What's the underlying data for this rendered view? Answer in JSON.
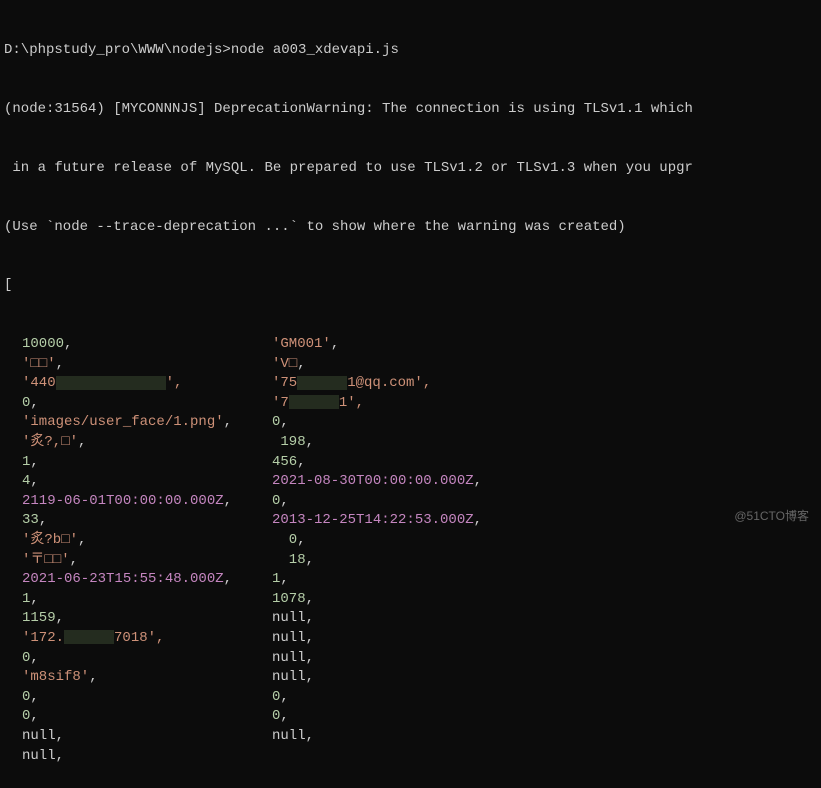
{
  "prompt_path": "D:\\phpstudy_pro\\WWW\\nodejs>",
  "command": "node a003_xdevapi.js",
  "warning_lines": [
    "(node:31564) [MYCONNNJS] DeprecationWarning: The connection is using TLSv1.1 which",
    " in a future release of MySQL. Be prepared to use TLSv1.2 or TLSv1.3 when you upgr",
    "(Use `node --trace-deprecation ...` to show where the warning was created)"
  ],
  "open_bracket": "[",
  "rows": [
    {
      "l": {
        "t": "num",
        "v": "10000"
      },
      "r": {
        "t": "str",
        "v": "'GM001'"
      }
    },
    {
      "l": {
        "t": "str",
        "v": "'□□'"
      },
      "r": {
        "t": "str",
        "v": "'V□"
      }
    },
    {
      "l": {
        "t": "str",
        "v": "'440",
        "censor": 110,
        "after": "',"
      },
      "r": {
        "t": "str",
        "v": "'75",
        "censor": 50,
        "after": "1@qq.com',"
      }
    },
    {
      "l": {
        "t": "num",
        "v": "0"
      },
      "r": {
        "t": "str",
        "v": "'7",
        "censor": 50,
        "after": "1',"
      }
    },
    {
      "l": {
        "t": "str",
        "v": "'images/user_face/1.png'"
      },
      "r": {
        "t": "num",
        "v": "0"
      }
    },
    {
      "l": {
        "t": "str",
        "v": "'炙?,□'"
      },
      "r": {
        "t": "num",
        "v": " 198",
        "indent": true
      }
    },
    {
      "l": {
        "t": "num",
        "v": "1"
      },
      "r": {
        "t": "num",
        "v": "456"
      }
    },
    {
      "l": {
        "t": "num",
        "v": "4"
      },
      "r": {
        "t": "date",
        "v": "2021-08-30T00:00:00.000Z"
      }
    },
    {
      "l": {
        "t": "date",
        "v": "2119-06-01T00:00:00.000Z"
      },
      "r": {
        "t": "num",
        "v": "0"
      }
    },
    {
      "l": {
        "t": "num",
        "v": "33"
      },
      "r": {
        "t": "date",
        "v": "2013-12-25T14:22:53.000Z"
      }
    },
    {
      "l": {
        "t": "str",
        "v": "'炙?b□'"
      },
      "r": {
        "t": "num",
        "v": "  0",
        "indent": true
      }
    },
    {
      "l": {
        "t": "str",
        "v": "'〒□□'"
      },
      "r": {
        "t": "num",
        "v": "  18",
        "indent": true
      }
    },
    {
      "l": {
        "t": "date",
        "v": "2021-06-23T15:55:48.000Z"
      },
      "r": {
        "t": "num",
        "v": "1"
      }
    },
    {
      "l": {
        "t": "num",
        "v": "1"
      },
      "r": {
        "t": "num",
        "v": "1078"
      }
    },
    {
      "l": {
        "t": "num",
        "v": "1159"
      },
      "r": {
        "t": "nul",
        "v": "null"
      }
    },
    {
      "l": {
        "t": "str",
        "v": "'172.",
        "censor": 50,
        "after": "7018',"
      },
      "r": {
        "t": "nul",
        "v": "null"
      }
    },
    {
      "l": {
        "t": "num",
        "v": "0"
      },
      "r": {
        "t": "nul",
        "v": "null"
      }
    },
    {
      "l": {
        "t": "str",
        "v": "'m8sif8'"
      },
      "r": {
        "t": "nul",
        "v": "null"
      }
    },
    {
      "l": {
        "t": "num",
        "v": "0"
      },
      "r": {
        "t": "num",
        "v": "0"
      }
    },
    {
      "l": {
        "t": "num",
        "v": "0"
      },
      "r": {
        "t": "num",
        "v": "0"
      }
    },
    {
      "l": {
        "t": "nul",
        "v": "null"
      },
      "r": {
        "t": "nul",
        "v": "null"
      }
    },
    {
      "l": {
        "t": "nul",
        "v": "null"
      },
      "r": null
    }
  ],
  "watermark": "@51CTO博客"
}
